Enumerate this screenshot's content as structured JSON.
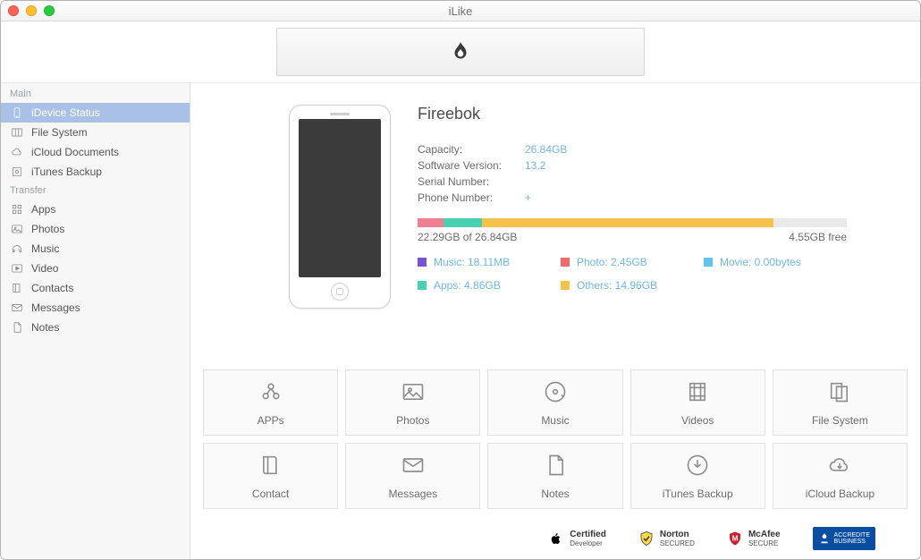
{
  "window": {
    "title": "iLike"
  },
  "sidebar": {
    "sections": [
      {
        "title": "Main",
        "items": [
          {
            "id": "idevice-status",
            "label": "iDevice Status",
            "icon": "phone-icon",
            "active": true
          },
          {
            "id": "file-system",
            "label": "File System",
            "icon": "columns-icon"
          },
          {
            "id": "icloud-docs",
            "label": "iCloud Documents",
            "icon": "cloud-icon"
          },
          {
            "id": "itunes-backup",
            "label": "iTunes Backup",
            "icon": "disk-icon"
          }
        ]
      },
      {
        "title": "Transfer",
        "items": [
          {
            "id": "apps",
            "label": "Apps",
            "icon": "grid-icon"
          },
          {
            "id": "photos",
            "label": "Photos",
            "icon": "image-icon"
          },
          {
            "id": "music",
            "label": "Music",
            "icon": "headphones-icon"
          },
          {
            "id": "video",
            "label": "Video",
            "icon": "play-icon"
          },
          {
            "id": "contacts",
            "label": "Contacts",
            "icon": "book-icon"
          },
          {
            "id": "messages",
            "label": "Messages",
            "icon": "mail-icon"
          },
          {
            "id": "notes",
            "label": "Notes",
            "icon": "note-icon"
          }
        ]
      }
    ]
  },
  "device": {
    "name": "Fireebok",
    "fields": {
      "capacity_label": "Capacity:",
      "capacity": "26.84GB",
      "version_label": "Software Version:",
      "version": "13.2",
      "serial_label": "Serial Number:",
      "serial": "",
      "phone_label": "Phone Number:",
      "phone": "+"
    },
    "usage": {
      "used_text": "22.29GB of 26.84GB",
      "free_text": "4.55GB free",
      "segments": [
        {
          "id": "music",
          "color": "#f07f91",
          "pct": 6
        },
        {
          "id": "apps",
          "color": "#48d1b0",
          "pct": 9
        },
        {
          "id": "others",
          "color": "#f7c24b",
          "pct": 68
        },
        {
          "id": "free",
          "color": "#e9e9e9",
          "pct": 17
        }
      ],
      "legend": [
        {
          "color": "#7b4fd6",
          "text": "Music: 18.11MB"
        },
        {
          "color": "#ef6b6b",
          "text": "Photo: 2.45GB"
        },
        {
          "color": "#5fc5ef",
          "text": "Movie: 0.00bytes"
        },
        {
          "color": "#48d1b0",
          "text": "Apps: 4.86GB"
        },
        {
          "color": "#f7c24b",
          "text": "Others: 14.96GB"
        }
      ]
    }
  },
  "tiles": [
    {
      "id": "apps",
      "label": "APPs",
      "icon": "apps-icon"
    },
    {
      "id": "photos",
      "label": "Photos",
      "icon": "image-icon"
    },
    {
      "id": "music",
      "label": "Music",
      "icon": "disc-icon"
    },
    {
      "id": "videos",
      "label": "Videos",
      "icon": "film-icon"
    },
    {
      "id": "fs",
      "label": "File System",
      "icon": "files-icon"
    },
    {
      "id": "contact",
      "label": "Contact",
      "icon": "book-icon"
    },
    {
      "id": "messages",
      "label": "Messages",
      "icon": "mail-icon"
    },
    {
      "id": "notes",
      "label": "Notes",
      "icon": "note-icon"
    },
    {
      "id": "itunes",
      "label": "iTunes Backup",
      "icon": "download-icon"
    },
    {
      "id": "icloud",
      "label": "iCloud Backup",
      "icon": "cloud-sync-icon"
    }
  ],
  "footer": {
    "certified": {
      "line1": "Certified",
      "line2": "Developer"
    },
    "norton": {
      "line1": "Norton",
      "line2": "SECURED"
    },
    "mcafee": {
      "line1": "McAfee",
      "line2": "SECURE"
    },
    "bbb": {
      "line1": "ACCREDITE",
      "line2": "BUSINESS"
    }
  }
}
